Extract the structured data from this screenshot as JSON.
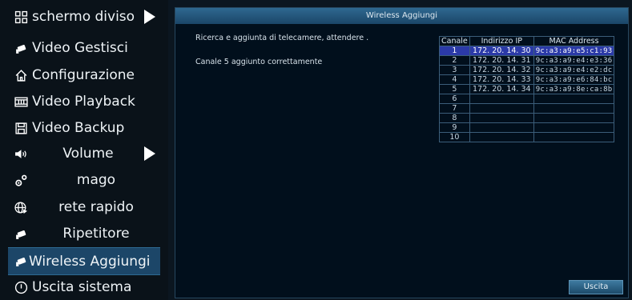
{
  "menu": {
    "items": [
      {
        "label": "schermo diviso",
        "icon": "grid-icon",
        "arrow": true
      },
      {
        "label": "Video Gestisci",
        "icon": "camera-icon",
        "arrow": false
      },
      {
        "label": "Configurazione",
        "icon": "home-icon",
        "arrow": false
      },
      {
        "label": "Video Playback",
        "icon": "film-icon",
        "arrow": false
      },
      {
        "label": "Video Backup",
        "icon": "floppy-icon",
        "arrow": false
      },
      {
        "label": "Volume",
        "icon": "speaker-icon",
        "arrow": true
      },
      {
        "label": "mago",
        "icon": "gears-icon",
        "arrow": false
      },
      {
        "label": "rete rapido",
        "icon": "globe-icon",
        "arrow": false
      },
      {
        "label": "Ripetitore",
        "icon": "camera-icon",
        "arrow": false
      },
      {
        "label": "Wireless Aggiungi",
        "icon": "camera-icon",
        "arrow": false,
        "active": true
      },
      {
        "label": "Uscita sistema",
        "icon": "power-icon",
        "arrow": false
      }
    ]
  },
  "panel": {
    "title": "Wireless Aggiungi",
    "status_search": "Ricerca e aggiunta di telecamere, attendere .",
    "status_added": "Canale 5 aggiunto correttamente",
    "exit_label": "Uscita"
  },
  "table": {
    "headers": [
      "Canale",
      "Indirizzo IP",
      "MAC Address"
    ],
    "rows": [
      {
        "ch": "1",
        "ip": "172. 20. 14. 30",
        "mac": "9c:a3:a9:e5:c1:93",
        "selected": true
      },
      {
        "ch": "2",
        "ip": "172. 20. 14. 31",
        "mac": "9c:a3:a9:e4:e3:36"
      },
      {
        "ch": "3",
        "ip": "172. 20. 14. 32",
        "mac": "9c:a3:a9:e4:e2:dc"
      },
      {
        "ch": "4",
        "ip": "172. 20. 14. 33",
        "mac": "9c:a3:a9:e6:84:bc"
      },
      {
        "ch": "5",
        "ip": "172. 20. 14. 34",
        "mac": "9c:a3:a9:8e:ca:8b"
      },
      {
        "ch": "6",
        "ip": "",
        "mac": ""
      },
      {
        "ch": "7",
        "ip": "",
        "mac": ""
      },
      {
        "ch": "8",
        "ip": "",
        "mac": ""
      },
      {
        "ch": "9",
        "ip": "",
        "mac": ""
      },
      {
        "ch": "10",
        "ip": "",
        "mac": ""
      }
    ]
  }
}
